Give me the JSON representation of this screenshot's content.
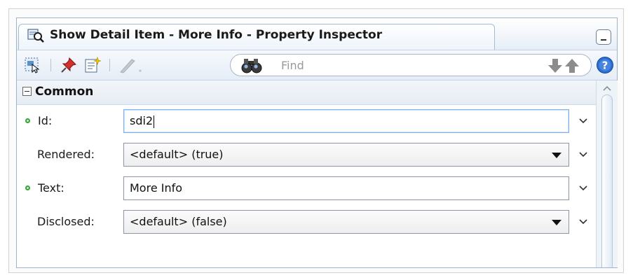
{
  "window": {
    "title": "Show Detail Item - More Info - Property Inspector"
  },
  "toolbar": {
    "search": {
      "placeholder": "Find",
      "value": ""
    }
  },
  "section": {
    "title": "Common",
    "expanded": true
  },
  "properties": [
    {
      "label": "Id:",
      "value": "sdi2",
      "required": true,
      "type": "text"
    },
    {
      "label": "Rendered:",
      "value": "<default> (true)",
      "required": false,
      "type": "select"
    },
    {
      "label": "Text:",
      "value": "More Info",
      "required": true,
      "type": "text"
    },
    {
      "label": "Disclosed:",
      "value": "<default> (false)",
      "required": false,
      "type": "select"
    }
  ],
  "icons": {
    "tab": "inspector-icon",
    "select": "select-component-icon",
    "pin": "pin-icon",
    "edit": "edit-properties-icon",
    "pencil": "pencil-icon",
    "find": "binoculars-icon",
    "down": "arrow-down-icon",
    "up": "arrow-up-icon",
    "help": "help-icon"
  },
  "colors": {
    "required_dot": "#35a43a",
    "help": "#2a6fd6",
    "pin": "#d0312d"
  }
}
